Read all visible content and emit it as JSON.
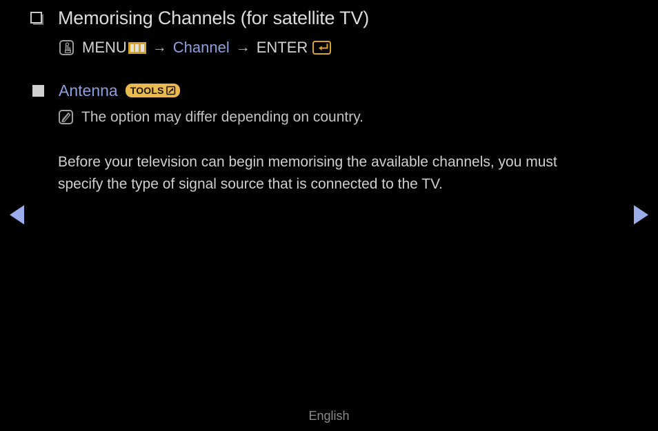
{
  "page": {
    "title": "Memorising Channels (for satellite TV)",
    "title_bullet_icon": "hollow-square-bullet-icon"
  },
  "menu_path": {
    "press_icon": "press-hand-icon",
    "menu_label": "MENU",
    "menu_icon": "menu-bars-icon",
    "arrow1": "→",
    "channel_label": "Channel",
    "arrow2": "→",
    "enter_label": "ENTER",
    "enter_icon": "enter-key-icon"
  },
  "section": {
    "bullet_icon": "solid-square-bullet-icon",
    "label": "Antenna",
    "tools_badge": {
      "text": "TOOLS",
      "icon": "tools-arrow-icon"
    }
  },
  "note": {
    "icon": "note-pencil-icon",
    "text": "The option may differ depending on country."
  },
  "body": {
    "paragraph": "Before your television can begin memorising the available channels, you must specify the type of signal source that is connected to the TV."
  },
  "navigation": {
    "prev_icon": "previous-page-arrow-icon",
    "next_icon": "next-page-arrow-icon"
  },
  "footer": {
    "language": "English"
  },
  "colors": {
    "background": "#000000",
    "body_text": "#cfcfcf",
    "accent_blue": "#8c9ee0",
    "accent_gold": "#d9a32a",
    "badge_gold": "#eab94f",
    "nav_arrow": "#9aadea",
    "footer_text": "#8a8a8a"
  }
}
